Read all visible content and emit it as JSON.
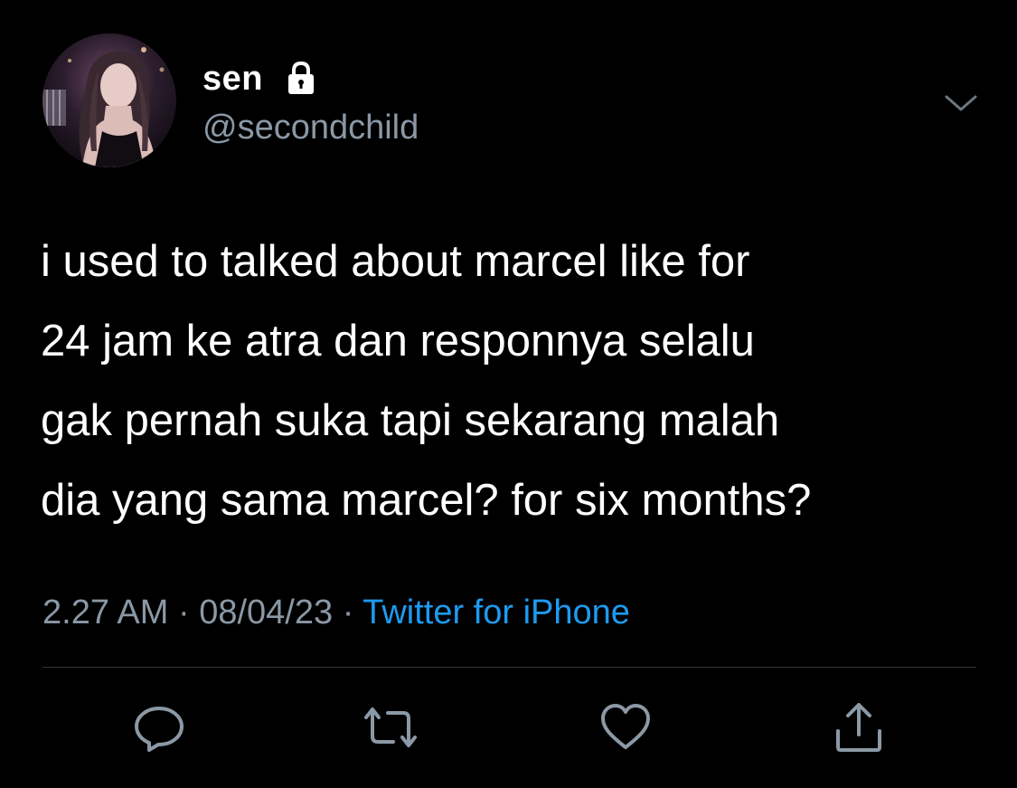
{
  "tweet": {
    "display_name": "sen",
    "username": "@secondchild",
    "text_lines": [
      "i used to talked about marcel like for",
      "24 jam ke atra dan responnya selalu",
      "gak pernah suka tapi sekarang malah",
      "dia yang sama marcel? for six months?"
    ],
    "time": "2.27 AM",
    "date": "08/04/23",
    "separator": "·",
    "source": "Twitter for iPhone"
  },
  "icons": {
    "protected": "lock-icon",
    "more": "chevron-down-icon",
    "reply": "reply-icon",
    "retweet": "retweet-icon",
    "like": "heart-icon",
    "share": "share-icon"
  },
  "colors": {
    "background": "#000000",
    "primary_text": "#ffffff",
    "secondary_text": "#8b98a5",
    "link": "#1d9bf0",
    "divider": "#2f3336"
  }
}
